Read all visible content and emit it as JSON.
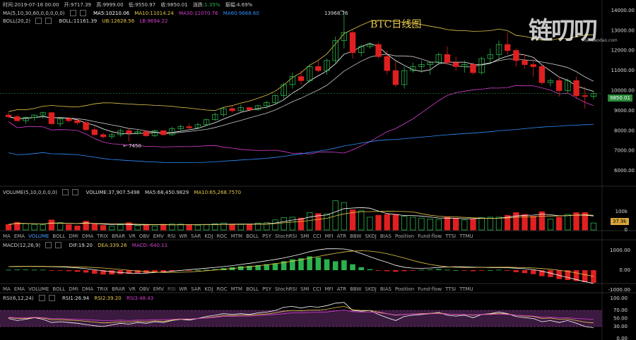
{
  "header": {
    "time": "时间:2019-07-18 00:00",
    "open": "开:9717.39",
    "high": "高:9999.00",
    "low": "低:9550.97",
    "close": "收:9850.01",
    "change_label": "涨跌:",
    "change_value": "1.35%",
    "amp": "振幅:4.69%"
  },
  "ma_line": {
    "label": "MA(5,10,30,60,0,0,0,0,0)",
    "ma5": "MA5:10210.06",
    "ma10": "MA10:11014.24",
    "ma30": "MA30:11070.76",
    "ma60": "MA60:9668.60"
  },
  "boll_line": {
    "label": "BOLL(20,2)",
    "boll": "BOLL:11161.39",
    "ub": "UB:12628.56",
    "lb": "LB:9694.22"
  },
  "vol_line": {
    "label": "VOLUME(5,10,0,0,0,0)",
    "volume": "VOLUME:37,907.5498",
    "ma5": "MA5:68,450.9829",
    "ma10": "MA10:65,268.7570"
  },
  "macd_line": {
    "label": "MACD(12,26,9)",
    "dif": "DIF:19.20",
    "dea": "DEA:339.26",
    "macd": "MACD:-640.11"
  },
  "rsi_line": {
    "label": "RSI(6,12,24)",
    "rsi1": "RSI1:26.94",
    "rsi2": "RSI2:39.20",
    "rsi3": "RSI3:48.43"
  },
  "indicators": [
    "MA",
    "EMA",
    "VOLUME",
    "BOLL",
    "DMI",
    "DMA",
    "TRIX",
    "BRAR",
    "VR",
    "OBV",
    "EMV",
    "RSI",
    "WR",
    "SAR",
    "KDJ",
    "ROC",
    "MTM",
    "BOLL",
    "PSY",
    "StochRSI",
    "SMI",
    "CCI",
    "MFI",
    "ATR",
    "BBW",
    "SKDJ",
    "BIAS",
    "Position",
    "Fund-flow",
    "TTSI",
    "TTMU"
  ],
  "chart_title": "BTC日线图",
  "watermark": "链叨叨",
  "watermark_sub": "liandaodao.com",
  "current_price": "9850.01",
  "current_volume": "37.9k",
  "high_marker": "13968.76",
  "low_marker": "7450",
  "colors": {
    "up": "#2bb24c",
    "down": "#e02020",
    "ma5": "#ffffff",
    "ma10": "#e6c84a",
    "ma30": "#d63fd0",
    "ma60": "#2f8fff",
    "boll": "#c9c9c9",
    "rsi_band": "#3a1a3e"
  },
  "chart_data": [
    {
      "type": "candlestick",
      "title": "BTC日线图",
      "yticks": [
        6000,
        7000,
        8000,
        9000,
        10000,
        11000,
        12000,
        13000,
        14000
      ],
      "ytick_labels": [
        "6000.00",
        "7000.00",
        "8000.00",
        "9000.00",
        "10000.00",
        "11000.00",
        "12000.00",
        "13000.00",
        "14000.00"
      ],
      "ylim": [
        5300,
        14100
      ],
      "candles": [
        [
          8780,
          8900,
          8620,
          8700
        ],
        [
          8700,
          8800,
          8450,
          8500
        ],
        [
          8500,
          8700,
          8350,
          8660
        ],
        [
          8660,
          8800,
          8500,
          8780
        ],
        [
          8780,
          8950,
          8600,
          8900
        ],
        [
          8900,
          8920,
          8300,
          8350
        ],
        [
          8350,
          8650,
          8200,
          8600
        ],
        [
          8600,
          8700,
          8400,
          8500
        ],
        [
          8500,
          8600,
          8300,
          8400
        ],
        [
          8400,
          8500,
          8000,
          8050
        ],
        [
          8050,
          8200,
          7750,
          7800
        ],
        [
          7800,
          7900,
          7600,
          7700
        ],
        [
          7700,
          7900,
          7600,
          7800
        ],
        [
          7800,
          8100,
          7700,
          8000
        ],
        [
          8000,
          8100,
          7450,
          7880
        ],
        [
          7880,
          8050,
          7800,
          7950
        ],
        [
          7950,
          8000,
          7700,
          7750
        ],
        [
          7750,
          8050,
          7700,
          8000
        ],
        [
          8000,
          8000,
          7750,
          7800
        ],
        [
          7800,
          8200,
          7750,
          8100
        ],
        [
          8100,
          8300,
          7950,
          8200
        ],
        [
          8200,
          8350,
          8050,
          8150
        ],
        [
          8150,
          8400,
          8100,
          8300
        ],
        [
          8300,
          8600,
          8250,
          8550
        ],
        [
          8550,
          8900,
          8500,
          8800
        ],
        [
          8800,
          9200,
          8700,
          9100
        ],
        [
          9100,
          9200,
          8900,
          9000
        ],
        [
          9000,
          9300,
          8950,
          9150
        ],
        [
          9150,
          9200,
          8950,
          9050
        ],
        [
          9050,
          9300,
          9000,
          9250
        ],
        [
          9250,
          9500,
          9100,
          9400
        ],
        [
          9400,
          9800,
          9300,
          9750
        ],
        [
          9750,
          10400,
          9600,
          10300
        ],
        [
          10300,
          10900,
          10100,
          10700
        ],
        [
          10700,
          11000,
          10300,
          10500
        ],
        [
          10500,
          11300,
          10400,
          11200
        ],
        [
          11200,
          11500,
          10900,
          11000
        ],
        [
          11000,
          11600,
          10800,
          11500
        ],
        [
          11500,
          12700,
          11300,
          12500
        ],
        [
          12500,
          13968.76,
          12100,
          12900
        ],
        [
          12900,
          13000,
          11600,
          11900
        ],
        [
          11900,
          12300,
          11700,
          12200
        ],
        [
          12200,
          12400,
          12100,
          12300
        ],
        [
          12300,
          12400,
          11600,
          11700
        ],
        [
          11700,
          12000,
          10800,
          11000
        ],
        [
          11000,
          11500,
          10200,
          10300
        ],
        [
          10300,
          11200,
          10100,
          11000
        ],
        [
          11000,
          11400,
          10900,
          11200
        ],
        [
          11200,
          11500,
          10900,
          11300
        ],
        [
          11300,
          11400,
          10800,
          11400
        ],
        [
          11400,
          11900,
          11300,
          11800
        ],
        [
          11800,
          12200,
          11300,
          11400
        ],
        [
          11400,
          11700,
          11000,
          11200
        ],
        [
          11200,
          11500,
          10900,
          11300
        ],
        [
          11300,
          11400,
          10800,
          10900
        ],
        [
          10900,
          11700,
          10800,
          11600
        ],
        [
          11600,
          12100,
          11400,
          11800
        ],
        [
          11800,
          12500,
          11500,
          12300
        ],
        [
          12300,
          12900,
          11800,
          12000
        ],
        [
          12000,
          12100,
          11200,
          11500
        ],
        [
          11500,
          11800,
          11100,
          11300
        ],
        [
          11300,
          11500,
          10700,
          11200
        ],
        [
          11200,
          11300,
          10300,
          10400
        ],
        [
          10400,
          10600,
          10200,
          10500
        ],
        [
          10500,
          10700,
          9700,
          10000
        ],
        [
          10000,
          10600,
          9900,
          10500
        ],
        [
          10500,
          10700,
          9600,
          9750
        ],
        [
          9750,
          10200,
          9100,
          9717
        ],
        [
          9717,
          9999,
          9550,
          9850
        ]
      ],
      "volumes": [
        30,
        42,
        35,
        30,
        28,
        55,
        40,
        30,
        22,
        48,
        35,
        25,
        20,
        28,
        40,
        25,
        28,
        22,
        30,
        33,
        32,
        28,
        26,
        30,
        34,
        38,
        30,
        30,
        28,
        38,
        40,
        55,
        68,
        70,
        65,
        95,
        90,
        88,
        160,
        150,
        110,
        105,
        70,
        80,
        85,
        85,
        75,
        70,
        65,
        60,
        58,
        70,
        65,
        55,
        60,
        68,
        70,
        70,
        80,
        95,
        85,
        75,
        100,
        60,
        70,
        85,
        95,
        95,
        38
      ]
    },
    {
      "type": "bar",
      "series": [
        {
          "name": "MACD",
          "values": [
            0.02,
            0.03,
            0.03,
            0.02,
            0.02,
            -0.02,
            -0.03,
            -0.05,
            -0.08,
            -0.12,
            -0.18,
            -0.22,
            -0.22,
            -0.2,
            -0.18,
            -0.16,
            -0.14,
            -0.12,
            -0.1,
            -0.06,
            -0.03,
            -0.02,
            0.0,
            0.02,
            0.05,
            0.1,
            0.15,
            0.2,
            0.22,
            0.25,
            0.3,
            0.35,
            0.45,
            0.55,
            0.6,
            0.7,
            0.65,
            0.55,
            0.45,
            0.5,
            0.3,
            0.15,
            0.05,
            -0.02,
            -0.05,
            -0.08,
            -0.05,
            -0.03,
            0.02,
            0.03,
            0.05,
            0.02,
            0.0,
            -0.02,
            -0.05,
            -0.03,
            0.0,
            0.02,
            -0.03,
            -0.1,
            -0.15,
            -0.2,
            -0.3,
            -0.35,
            -0.45,
            -0.5,
            -0.55,
            -0.6,
            -0.64
          ]
        }
      ],
      "yticks": [
        1000,
        0,
        -1000
      ],
      "ytick_labels": [
        "1000.00",
        "0.00",
        "-1000.00"
      ]
    },
    {
      "type": "line",
      "yticks": [
        100,
        70,
        50,
        30,
        0
      ],
      "ytick_labels": [
        "100.00",
        "70.00",
        "50.00",
        "30.00",
        "0.00"
      ],
      "series": [
        {
          "name": "RSI1",
          "values": [
            50,
            45,
            48,
            52,
            48,
            40,
            42,
            40,
            38,
            35,
            32,
            30,
            34,
            38,
            36,
            40,
            38,
            42,
            40,
            45,
            48,
            46,
            50,
            55,
            58,
            62,
            60,
            62,
            60,
            64,
            66,
            70,
            78,
            80,
            76,
            80,
            78,
            82,
            88,
            90,
            70,
            68,
            70,
            60,
            52,
            45,
            55,
            58,
            60,
            62,
            65,
            58,
            56,
            58,
            52,
            60,
            62,
            66,
            62,
            55,
            52,
            50,
            42,
            45,
            40,
            45,
            38,
            30,
            27
          ]
        },
        {
          "name": "RSI2",
          "values": [
            52,
            50,
            50,
            52,
            51,
            47,
            47,
            46,
            45,
            43,
            41,
            39,
            40,
            42,
            41,
            43,
            42,
            44,
            43,
            46,
            48,
            48,
            50,
            52,
            54,
            57,
            57,
            58,
            58,
            60,
            61,
            64,
            68,
            70,
            69,
            71,
            71,
            73,
            77,
            80,
            72,
            70,
            70,
            66,
            62,
            58,
            60,
            61,
            62,
            63,
            64,
            61,
            60,
            60,
            58,
            60,
            61,
            63,
            61,
            58,
            56,
            55,
            50,
            51,
            48,
            49,
            45,
            41,
            39
          ]
        },
        {
          "name": "RSI3",
          "values": [
            53,
            52,
            52,
            53,
            52,
            50,
            50,
            49,
            48,
            47,
            46,
            45,
            45,
            46,
            45,
            46,
            46,
            47,
            47,
            48,
            49,
            49,
            50,
            51,
            53,
            55,
            55,
            56,
            56,
            57,
            58,
            60,
            62,
            64,
            64,
            65,
            65,
            66,
            69,
            71,
            67,
            66,
            66,
            64,
            62,
            59,
            60,
            61,
            61,
            62,
            62,
            61,
            60,
            60,
            59,
            60,
            60,
            61,
            60,
            58,
            57,
            56,
            53,
            53,
            52,
            52,
            50,
            49,
            48
          ]
        }
      ]
    }
  ]
}
